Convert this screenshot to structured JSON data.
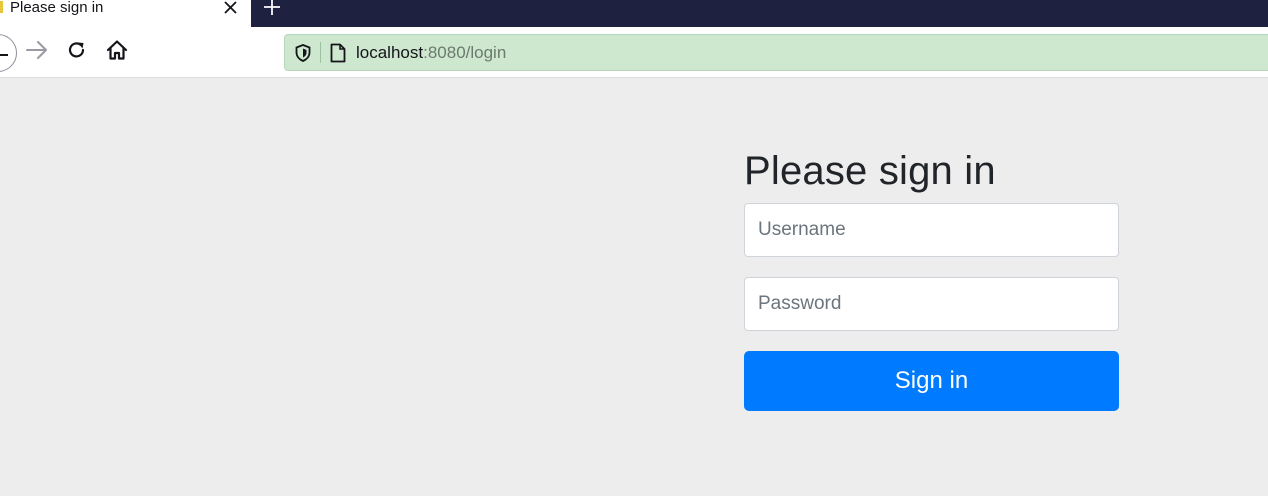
{
  "browser": {
    "tab": {
      "title": "Please sign in"
    },
    "toolbar": {
      "url_host": "localhost",
      "url_rest": ":8080/login"
    },
    "icons": {
      "tab_close": "close-icon",
      "new_tab": "plus-icon",
      "back": "arrow-left-icon",
      "forward": "arrow-right-icon",
      "reload": "reload-icon",
      "home": "home-icon",
      "tracking": "shield-icon",
      "page": "page-icon"
    },
    "colors": {
      "tabstrip_bg": "#1f2140",
      "urlbar_bg": "#cde8cf"
    }
  },
  "login": {
    "heading": "Please sign in",
    "username_placeholder": "Username",
    "password_placeholder": "Password",
    "submit_label": "Sign in",
    "colors": {
      "page_bg": "#ededed",
      "button_bg": "#007bff",
      "button_text": "#ffffff"
    }
  }
}
